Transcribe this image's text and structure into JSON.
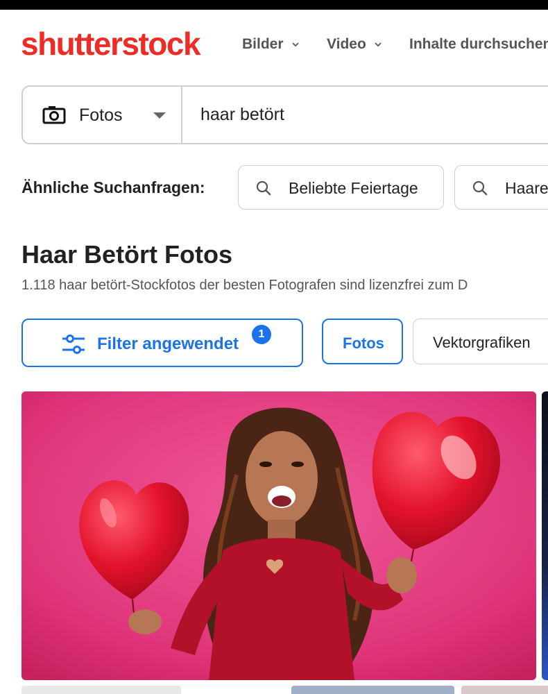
{
  "brand": {
    "logo_text": "shutterstock",
    "logo_color": "#ee2b24"
  },
  "nav": [
    {
      "label": "Bilder"
    },
    {
      "label": "Video"
    },
    {
      "label": "Inhalte durchsuchen"
    }
  ],
  "search": {
    "type_label": "Fotos",
    "query": "haar betört"
  },
  "related": {
    "label": "Ähnliche Suchanfragen:",
    "items": [
      "Beliebte Feiertage",
      "Haare"
    ]
  },
  "results": {
    "title": "Haar Betört Fotos",
    "subtitle": "1.118 haar betört-Stockfotos der besten Fotografen sind lizenzfrei zum D"
  },
  "filters": {
    "filter_button_label": "Filter angewendet",
    "filter_count": "1",
    "types": [
      {
        "label": "Fotos",
        "active": true
      },
      {
        "label": "Vektorgrafiken",
        "active": false
      }
    ]
  },
  "colors": {
    "accent": "#1a73e8",
    "photo_background": "#e0357a"
  }
}
